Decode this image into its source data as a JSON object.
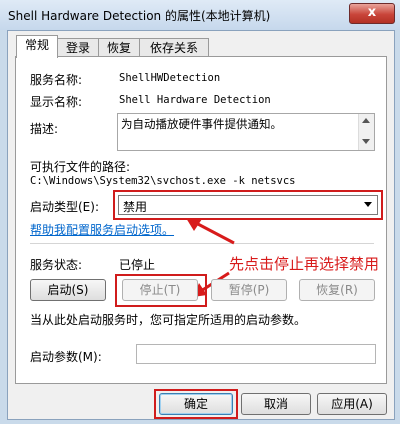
{
  "window": {
    "title": "Shell Hardware Detection 的属性(本地计算机)",
    "close_glyph": "x"
  },
  "tabs": [
    {
      "label": "常规",
      "active": true
    },
    {
      "label": "登录",
      "active": false
    },
    {
      "label": "恢复",
      "active": false
    },
    {
      "label": "依存关系",
      "active": false
    }
  ],
  "general": {
    "service_name_label": "服务名称:",
    "service_name": "ShellHWDetection",
    "display_name_label": "显示名称:",
    "display_name": "Shell Hardware Detection",
    "description_label": "描述:",
    "description": "为自动播放硬件事件提供通知。",
    "path_label": "可执行文件的路径:",
    "path": "C:\\Windows\\System32\\svchost.exe -k netsvcs",
    "startup_type_label": "启动类型(E):",
    "startup_type_value": "禁用",
    "help_link": "帮助我配置服务启动选项。",
    "service_status_label": "服务状态:",
    "service_status": "已停止",
    "buttons": {
      "start": "启动(S)",
      "stop": "停止(T)",
      "pause": "暂停(P)",
      "resume": "恢复(R)"
    },
    "start_params_hint": "当从此处启动服务时，您可指定所适用的启动参数。",
    "start_params_label": "启动参数(M):",
    "start_params_value": ""
  },
  "annotation": {
    "text": "先点击停止再选择禁用",
    "color": "#d81b1b"
  },
  "footer": {
    "ok": "确定",
    "cancel": "取消",
    "apply": "应用(A)"
  }
}
